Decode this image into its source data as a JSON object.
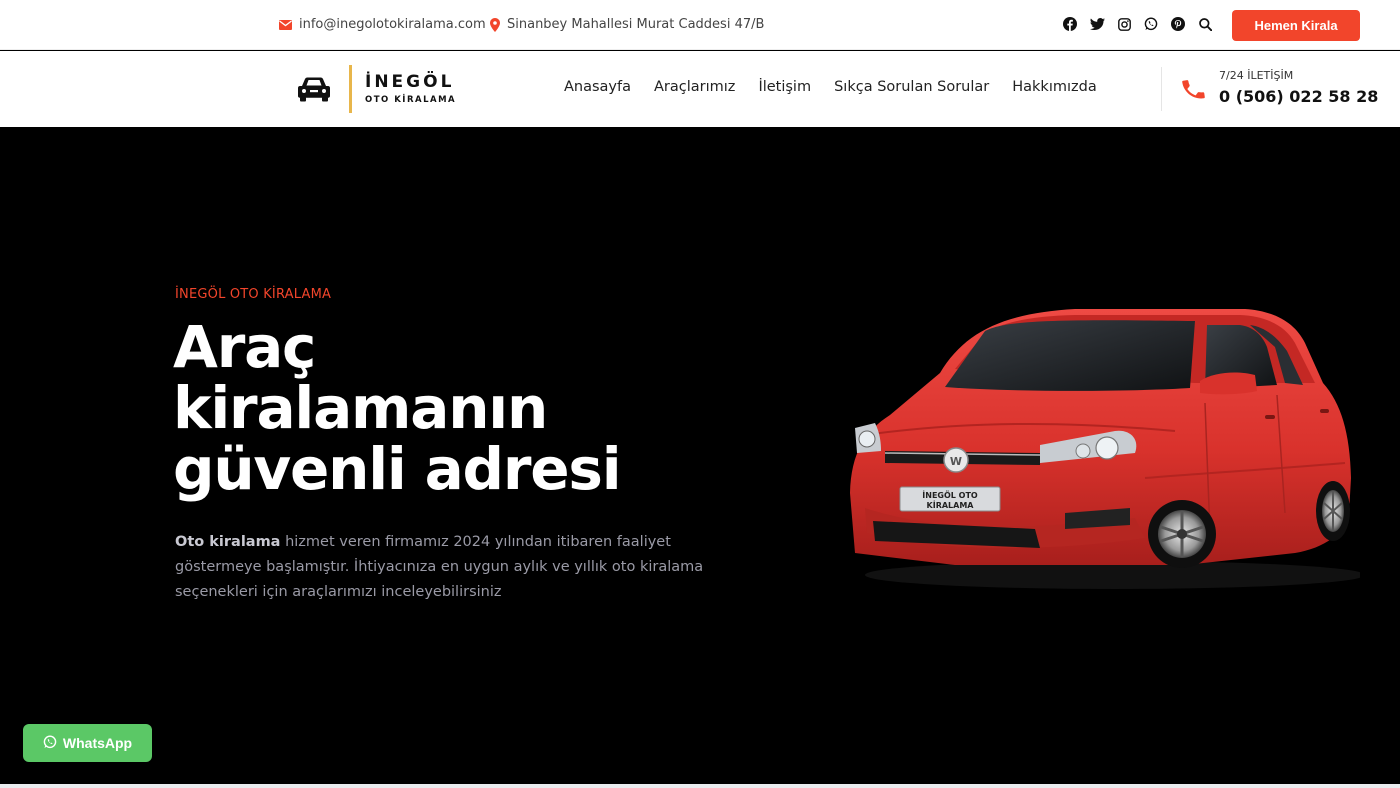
{
  "topbar": {
    "email": "info@inegolotokiralama.com",
    "address": "Sinanbey Mahallesi Murat Caddesi 47/B",
    "socials": [
      "facebook-icon",
      "twitter-icon",
      "instagram-icon",
      "whatsapp-icon",
      "pinterest-icon",
      "search-icon"
    ],
    "cta_label": "Hemen Kirala"
  },
  "header": {
    "brand_line1": "İNEGÖL",
    "brand_line2": "OTO KİRALAMA",
    "nav": [
      "Anasayfa",
      "Araçlarımız",
      "İletişim",
      "Sıkça Sorulan Sorular",
      "Hakkımızda"
    ],
    "contact_label": "7/24 İLETİŞİM",
    "phone": "0 (506) 022 58 28"
  },
  "hero": {
    "eyebrow": "İNEGÖL OTO KİRALAMA",
    "headline_line1": "Araç",
    "headline_line2": "kiralamanın",
    "headline_line3": "güvenli adresi",
    "desc_bold": "Oto kiralama",
    "desc_rest": " hizmet veren firmamız 2024 yılından itibaren faaliyet göstermeye başlamıştır. İhtiyacınıza en uygun aylık ve yıllık oto kiralama seçenekleri için araçlarımızı inceleyebilirsiniz",
    "plate_line1": "İNEGÖL OTO",
    "plate_line2": "KİRALAMA"
  },
  "whatsapp_label": "WhatsApp",
  "colors": {
    "accent": "#f2452b",
    "logo_bar": "#e8b64b",
    "whatsapp": "#5bc866",
    "car": "#d9322c"
  }
}
